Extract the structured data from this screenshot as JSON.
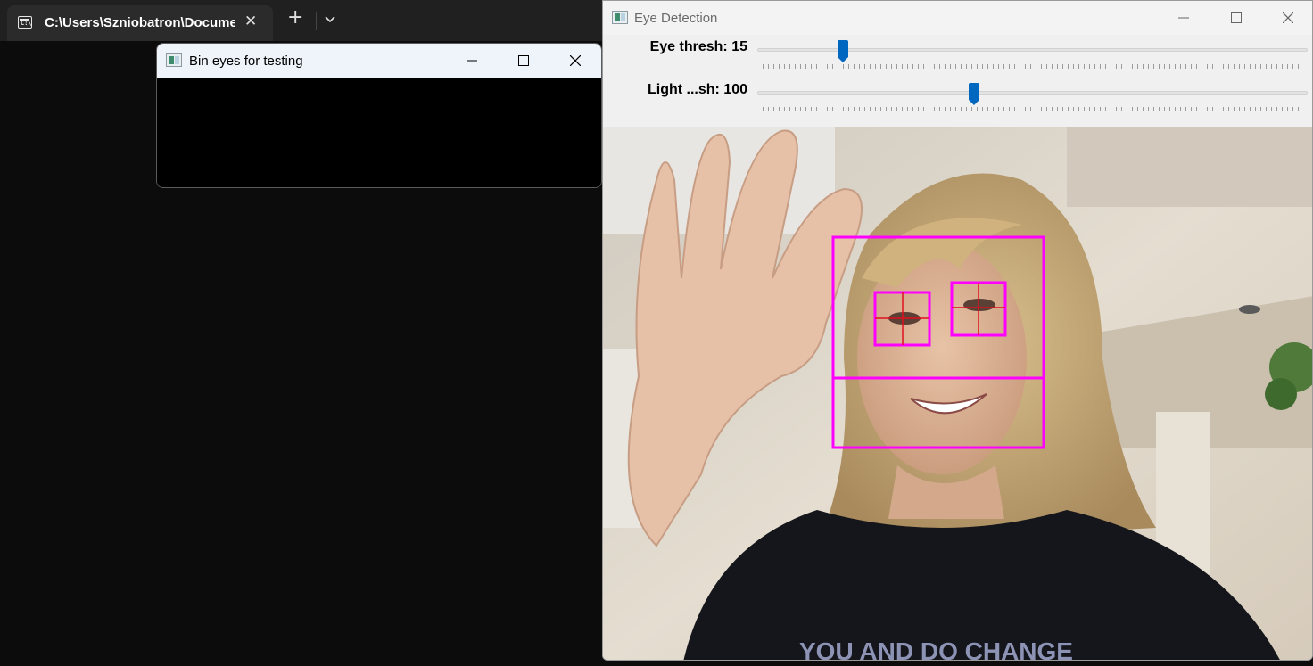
{
  "terminal": {
    "tab_title": "C:\\Users\\Szniobatron\\Docume",
    "tab_icon_text": "C:\\"
  },
  "bin_window": {
    "title": "Bin eyes for testing"
  },
  "eye_window": {
    "title": "Eye Detection",
    "trackbars": [
      {
        "label": "Eye thresh: 15",
        "value": 15
      },
      {
        "label": "Light ...sh: 100",
        "value": 100
      }
    ]
  },
  "detection": {
    "box_color": "#ff00ff",
    "crosshair_color": "#e01020"
  },
  "colors": {
    "slider_thumb": "#0067c0",
    "terminal_bg": "#0c0c0c"
  }
}
